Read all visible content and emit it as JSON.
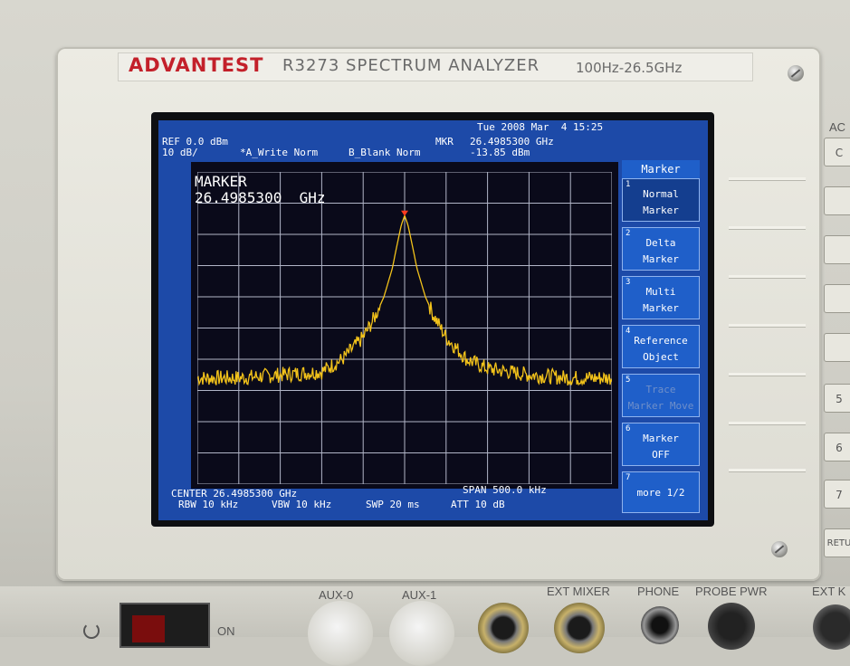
{
  "instrument": {
    "brand": "ADVANTEST",
    "model": "R3273 SPECTRUM ANALYZER",
    "range": "100Hz-26.5GHz"
  },
  "header": {
    "datetime": "Tue 2008 Mar  4 15:25",
    "ref": "REF 0.0 dBm",
    "scale": "10 dB/",
    "trace_a": "*A_Write Norm",
    "trace_b": "B_Blank Norm",
    "mkr_label": "MKR",
    "mkr_freq": "26.4985300 GHz",
    "mkr_level": "-13.85 dBm"
  },
  "marker_readout": {
    "title": "MARKER",
    "value": "26.4985300  GHz"
  },
  "footer": {
    "center": "CENTER 26.4985300 GHz",
    "span": "SPAN 500.0 kHz",
    "rbw": "RBW 10 kHz",
    "vbw": "VBW 10 kHz",
    "swp": "SWP 20 ms",
    "att": "ATT 10 dB"
  },
  "softkey_menu": {
    "title": "Marker",
    "keys": [
      {
        "num": "1",
        "label": "Normal\nMarker"
      },
      {
        "num": "2",
        "label": "Delta\nMarker"
      },
      {
        "num": "3",
        "label": "Multi\nMarker"
      },
      {
        "num": "4",
        "label": "Reference\nObject"
      },
      {
        "num": "5",
        "label": "Trace\nMarker Move"
      },
      {
        "num": "6",
        "label": "Marker\nOFF"
      },
      {
        "num": "7",
        "label": "more 1/2"
      }
    ]
  },
  "side_keys": [
    "AC",
    "C",
    "",
    "",
    "",
    "",
    "5",
    "6",
    "7",
    "RETU"
  ],
  "front_panel": {
    "aux0": "AUX-0",
    "aux1": "AUX-1",
    "ext_mixer": "EXT MIXER",
    "phone": "PHONE",
    "probe_pwr": "PROBE PWR",
    "ext_k": "EXT K",
    "power_on": "ON"
  },
  "colors": {
    "screen_bg": "#1d4aa8",
    "trace": "#f2c21a",
    "marker": "#ff3b1f",
    "brand_red": "#c3202a"
  },
  "chart_data": {
    "type": "line",
    "title": "",
    "xlabel": "",
    "ylabel": "",
    "center_ghz": 26.49853,
    "span_khz": 500,
    "xlim_khz": [
      -250,
      250
    ],
    "ref_level_dbm": 0,
    "scale_db_per_div": 10,
    "ylim_dbm": [
      -100,
      0
    ],
    "grid": true,
    "series": [
      {
        "x_khz_offset": [
          -250,
          -200,
          -150,
          -100,
          -75,
          -50,
          -35,
          -25,
          -15,
          -8,
          -4,
          0,
          4,
          8,
          15,
          25,
          35,
          50,
          75,
          100,
          150,
          200,
          250
        ],
        "y_dbm": [
          -66,
          -66,
          -65,
          -64,
          -60,
          -53,
          -46,
          -40,
          -31,
          -22,
          -17,
          -14,
          -17,
          -22,
          -31,
          -40,
          -46,
          -53,
          -60,
          -63,
          -65,
          -66,
          -66
        ]
      }
    ],
    "marker": {
      "x_khz_offset": 0,
      "y_dbm": -13.85
    }
  }
}
